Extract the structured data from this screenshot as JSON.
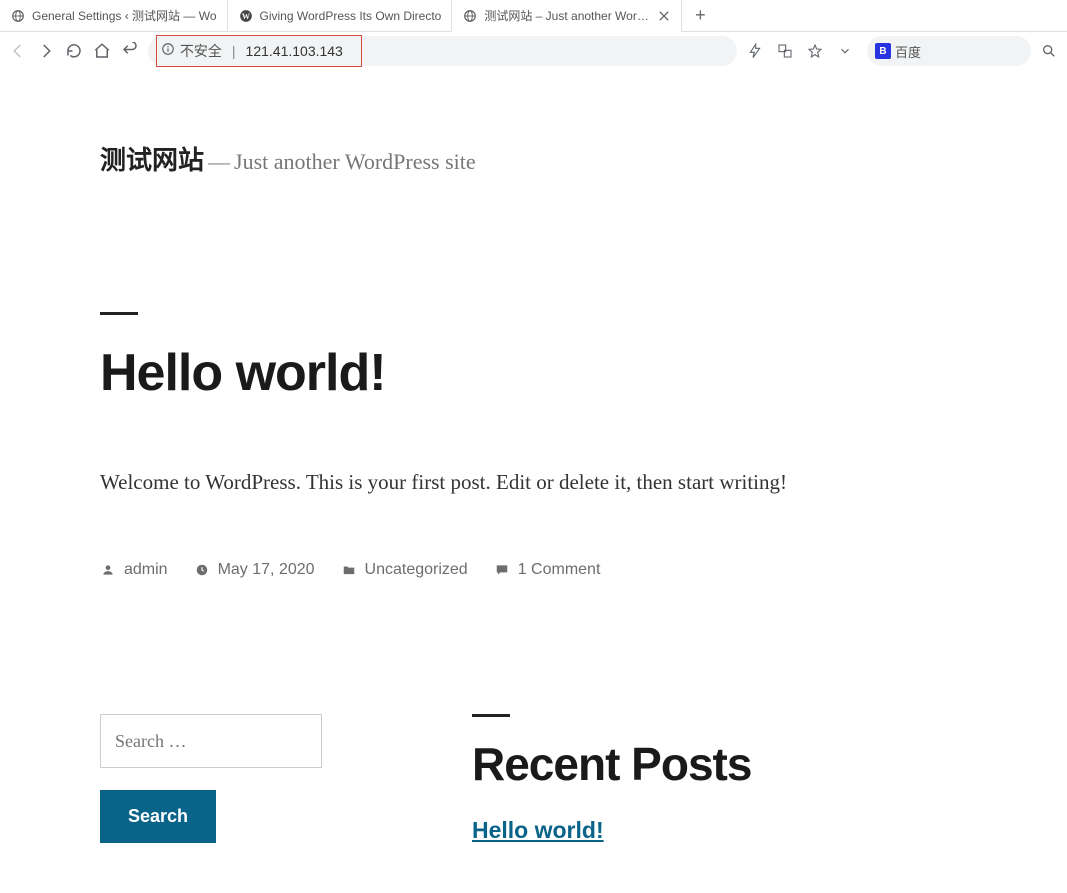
{
  "browser": {
    "tabs": [
      {
        "title": "General Settings ‹ 测试网站 — Wo"
      },
      {
        "title": "Giving WordPress Its Own Directo"
      },
      {
        "title": "测试网站 – Just another WordP"
      }
    ],
    "address": {
      "insecure_label": "不安全",
      "url": "121.41.103.143"
    },
    "search_engine": "百度"
  },
  "site": {
    "title": "测试网站",
    "tagline_sep": "—",
    "tagline": "Just another WordPress site"
  },
  "post": {
    "title": "Hello world!",
    "body": "Welcome to WordPress. This is your first post. Edit or delete it, then start writing!",
    "meta": {
      "author": "admin",
      "date": "May 17, 2020",
      "category": "Uncategorized",
      "comments": "1 Comment"
    }
  },
  "widgets": {
    "search": {
      "placeholder": "Search …",
      "button": "Search"
    },
    "recent": {
      "title": "Recent Posts",
      "items": [
        {
          "title": "Hello world!"
        }
      ]
    }
  }
}
